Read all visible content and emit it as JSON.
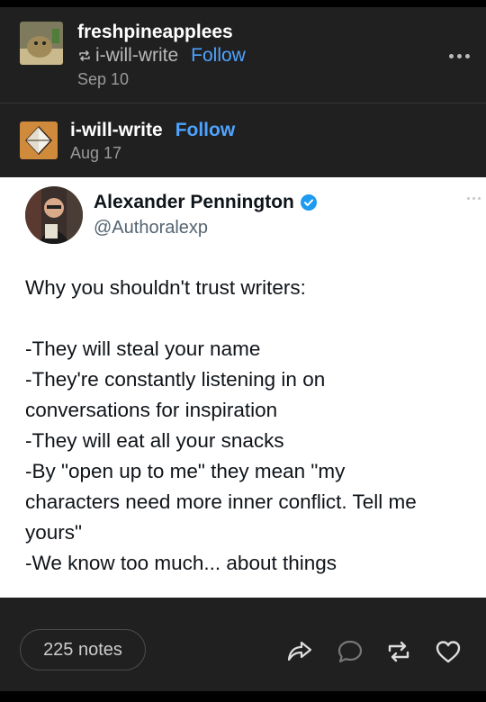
{
  "reblogger": {
    "username": "freshpineapplees",
    "reblogged_from": "i-will-write",
    "follow_label": "Follow",
    "date": "Sep 10"
  },
  "original_poster": {
    "username": "i-will-write",
    "follow_label": "Follow",
    "date": "Aug 17"
  },
  "tweet": {
    "name": "Alexander Pennington",
    "handle": "@Authoralexp",
    "lines": [
      "Why you shouldn't trust writers:",
      "",
      "-They will steal your name",
      "-They're constantly listening in on",
      "conversations for inspiration",
      "-They will eat all your snacks",
      "-By \"open up to me\" they mean \"my",
      "characters need more inner conflict. Tell me",
      "yours\"",
      "-We know too much... about things"
    ]
  },
  "footer": {
    "notes_label": "225 notes"
  },
  "icons": {
    "reblog": "reblog-icon",
    "share": "share-icon",
    "reply": "reply-icon",
    "like": "heart-icon",
    "more": "more-icon",
    "verified": "verified-badge-icon"
  },
  "colors": {
    "follow": "#4ea3ff",
    "verified": "#1d9bf0",
    "post_bg": "#202020",
    "tweet_bg": "#ffffff"
  }
}
